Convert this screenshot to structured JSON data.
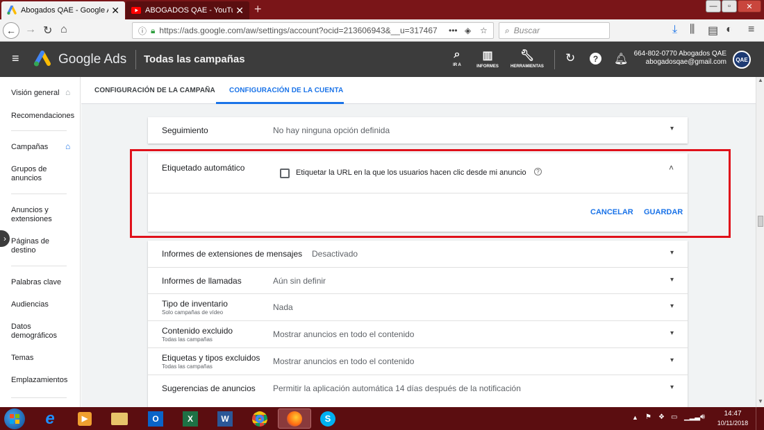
{
  "browser": {
    "tabs": [
      {
        "title": "Abogados QAE - Google Ads",
        "close": "✕"
      },
      {
        "title": "ABOGADOS QAE - YouTube",
        "close": "✕"
      }
    ],
    "new_tab": "+",
    "url": "https://ads.google.com/aw/settings/account?ocid=213606943&__u=317467",
    "url_more": "•••",
    "search_placeholder": "Buscar"
  },
  "ads_header": {
    "product": "Google Ads",
    "page_title": "Todas las campañas",
    "tools": [
      {
        "label": "IR A",
        "icon": "search-icon"
      },
      {
        "label": "INFORMES",
        "icon": "bar-chart-icon"
      },
      {
        "label": "HERRAMIENTAS",
        "icon": "wrench-icon"
      }
    ],
    "account_id": "664-802-0770 Abogados QAE",
    "account_email": "abogadosqae@gmail.com",
    "avatar_text": "QAE"
  },
  "sidebar": {
    "items": [
      {
        "label": "Visión general"
      },
      {
        "label": "Recomendaciones"
      },
      {
        "label": "Campañas"
      },
      {
        "label": "Grupos de anuncios"
      },
      {
        "label": "Anuncios y extensiones"
      },
      {
        "label": "Páginas de destino"
      },
      {
        "label": "Palabras clave"
      },
      {
        "label": "Audiencias"
      },
      {
        "label": "Datos demográficos"
      },
      {
        "label": "Temas"
      },
      {
        "label": "Emplazamientos"
      }
    ]
  },
  "subtabs": [
    {
      "label": "CONFIGURACIÓN DE LA CAMPAÑA"
    },
    {
      "label": "CONFIGURACIÓN DE LA CUENTA"
    }
  ],
  "settings": {
    "seguimiento": {
      "label": "Seguimiento",
      "value": "No hay ninguna opción definida"
    },
    "auto_tagging": {
      "label": "Etiquetado automático",
      "checkbox_label": "Etiquetar la URL en la que los usuarios hacen clic desde mi anuncio",
      "checked": false,
      "cancel": "CANCELAR",
      "save": "GUARDAR"
    },
    "rows": [
      {
        "label": "Informes de extensiones de mensajes",
        "sub": "",
        "value": "Desactivado"
      },
      {
        "label": "Informes de llamadas",
        "sub": "",
        "value": "Aún sin definir"
      },
      {
        "label": "Tipo de inventario",
        "sub": "Solo campañas de vídeo",
        "value": "Nada"
      },
      {
        "label": "Contenido excluido",
        "sub": "Todas las campañas",
        "value": "Mostrar anuncios en todo el contenido"
      },
      {
        "label": "Etiquetas y tipos excluidos",
        "sub": "Todas las campañas",
        "value": "Mostrar anuncios en todo el contenido"
      },
      {
        "label": "Sugerencias de anuncios",
        "sub": "",
        "value": "Permitir la aplicación automática 14 días después de la notificación"
      }
    ]
  },
  "taskbar": {
    "time": "14:47",
    "date": "10/11/2018"
  },
  "colors": {
    "accent_blue": "#1a73e8",
    "highlight_red": "#e0101a",
    "ads_header": "#3c3c3c",
    "taskbar": "#5b0d10"
  }
}
